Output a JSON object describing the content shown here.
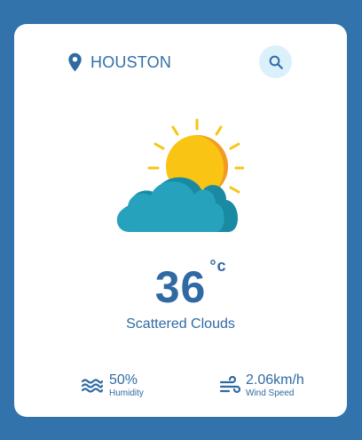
{
  "location": {
    "icon": "map-pin-icon",
    "city": "HOUSTON"
  },
  "search": {
    "icon": "search-icon"
  },
  "weather": {
    "icon": "partly-cloudy-icon",
    "temperature": "36",
    "unit": "°c",
    "description": "Scattered Clouds"
  },
  "stats": {
    "humidity": {
      "icon": "waves-icon",
      "value": "50%",
      "label": "Humidity"
    },
    "wind": {
      "icon": "wind-icon",
      "value": "2.06km/h",
      "label": "Wind Speed"
    }
  },
  "colors": {
    "background": "#3373ab",
    "card": "#ffffff",
    "text": "#2f6aa3",
    "search_bg": "#daf1fb",
    "sun": "#f9c413",
    "sun_shade": "#f19a24",
    "cloud": "#27a2bd",
    "cloud_shade": "#1a8aa2"
  }
}
